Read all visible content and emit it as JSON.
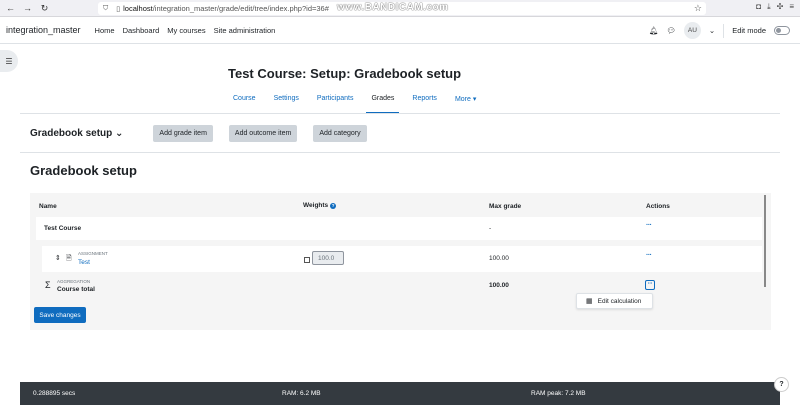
{
  "browser": {
    "url_host": "localhost",
    "url_path": "/integration_master/grade/edit/tree/index.php?id=36#",
    "watermark": "www.BANDICAM.com"
  },
  "navbar": {
    "brand": "integration_master",
    "items": [
      "Home",
      "Dashboard",
      "My courses",
      "Site administration"
    ],
    "avatar": "AU",
    "edit_mode_label": "Edit mode"
  },
  "page": {
    "title": "Test Course: Setup: Gradebook setup",
    "tabs": [
      "Course",
      "Settings",
      "Participants",
      "Grades",
      "Reports",
      "More"
    ],
    "active_tab": "Grades"
  },
  "tertiary": {
    "title": "Gradebook setup",
    "buttons": [
      "Add grade item",
      "Add outcome item",
      "Add category"
    ]
  },
  "content_title": "Gradebook setup",
  "table": {
    "headers": {
      "name": "Name",
      "weights": "Weights",
      "max_grade": "Max grade",
      "actions": "Actions"
    },
    "category": {
      "name": "Test Course",
      "max_grade": "-"
    },
    "item": {
      "type": "ASSIGNMENT",
      "name": "Test",
      "weight": "100.0",
      "max_grade": "100.00"
    },
    "total": {
      "type": "AGGREGATION",
      "name": "Course total",
      "max_grade": "100.00"
    }
  },
  "dropdown": {
    "item": "Edit calculation"
  },
  "save_button": "Save changes",
  "footer": {
    "time": "0.288895 secs",
    "ram": "RAM: 6.2 MB",
    "ram_peak": "RAM peak: 7.2 MB"
  },
  "help": "?"
}
